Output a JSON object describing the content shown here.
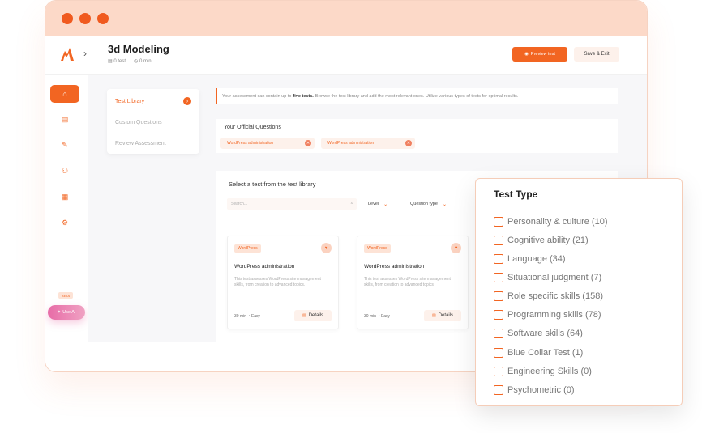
{
  "header": {
    "title": "3d Modeling",
    "tests_count": "0 test",
    "duration": "0 min",
    "preview_label": "Preview test",
    "save_label": "Save & Exit"
  },
  "sidebar": {
    "items": [
      {
        "icon": "home-icon"
      },
      {
        "icon": "document-icon"
      },
      {
        "icon": "edit-document-icon"
      },
      {
        "icon": "users-icon"
      },
      {
        "icon": "calendar-icon"
      },
      {
        "icon": "gear-icon"
      }
    ],
    "beta_label": "BETA",
    "use_ai_label": "Use AI"
  },
  "steps": [
    {
      "label": "Test Library",
      "active": true
    },
    {
      "label": "Custom Questions",
      "active": false
    },
    {
      "label": "Review Assessment",
      "active": false
    }
  ],
  "notice": {
    "prefix": "Your assessment can contain up to",
    "highlight": "five tests.",
    "suffix": "Browse the test library and add the most relevant ones. Utilize various types of tests for optimal results."
  },
  "official": {
    "title": "Your Official Questions",
    "chips": [
      "WordPress administration",
      "WordPress administration"
    ]
  },
  "library": {
    "title": "Select a test from the test library",
    "search_placeholder": "Search...",
    "filters": [
      "Level",
      "Question type"
    ],
    "cards": [
      {
        "tag": "WordPress",
        "title": "WordPress administration",
        "description": "This test assesses WordPress site management skills, from creation to advanced topics.",
        "duration": "30 min",
        "level": "Easy",
        "details_label": "Details"
      },
      {
        "tag": "WordPress",
        "title": "WordPress administration",
        "description": "This test assesses WordPress site management skills, from creation to advanced topics.",
        "duration": "30 min",
        "level": "Easy",
        "details_label": "Details"
      }
    ]
  },
  "filter_panel": {
    "title": "Test Type",
    "options": [
      "Personality & culture (10)",
      "Cognitive ability (21)",
      "Language (34)",
      "Situational judgment (7)",
      "Role specific skills (158)",
      "Programming skills (78)",
      "Software skills (64)",
      "Blue Collar Test (1)",
      "Engineering Skills (0)",
      "Psychometric (0)"
    ]
  },
  "colors": {
    "accent": "#f26522",
    "titlebar": "#fcd9c8",
    "chip_bg": "#fdf1eb"
  }
}
